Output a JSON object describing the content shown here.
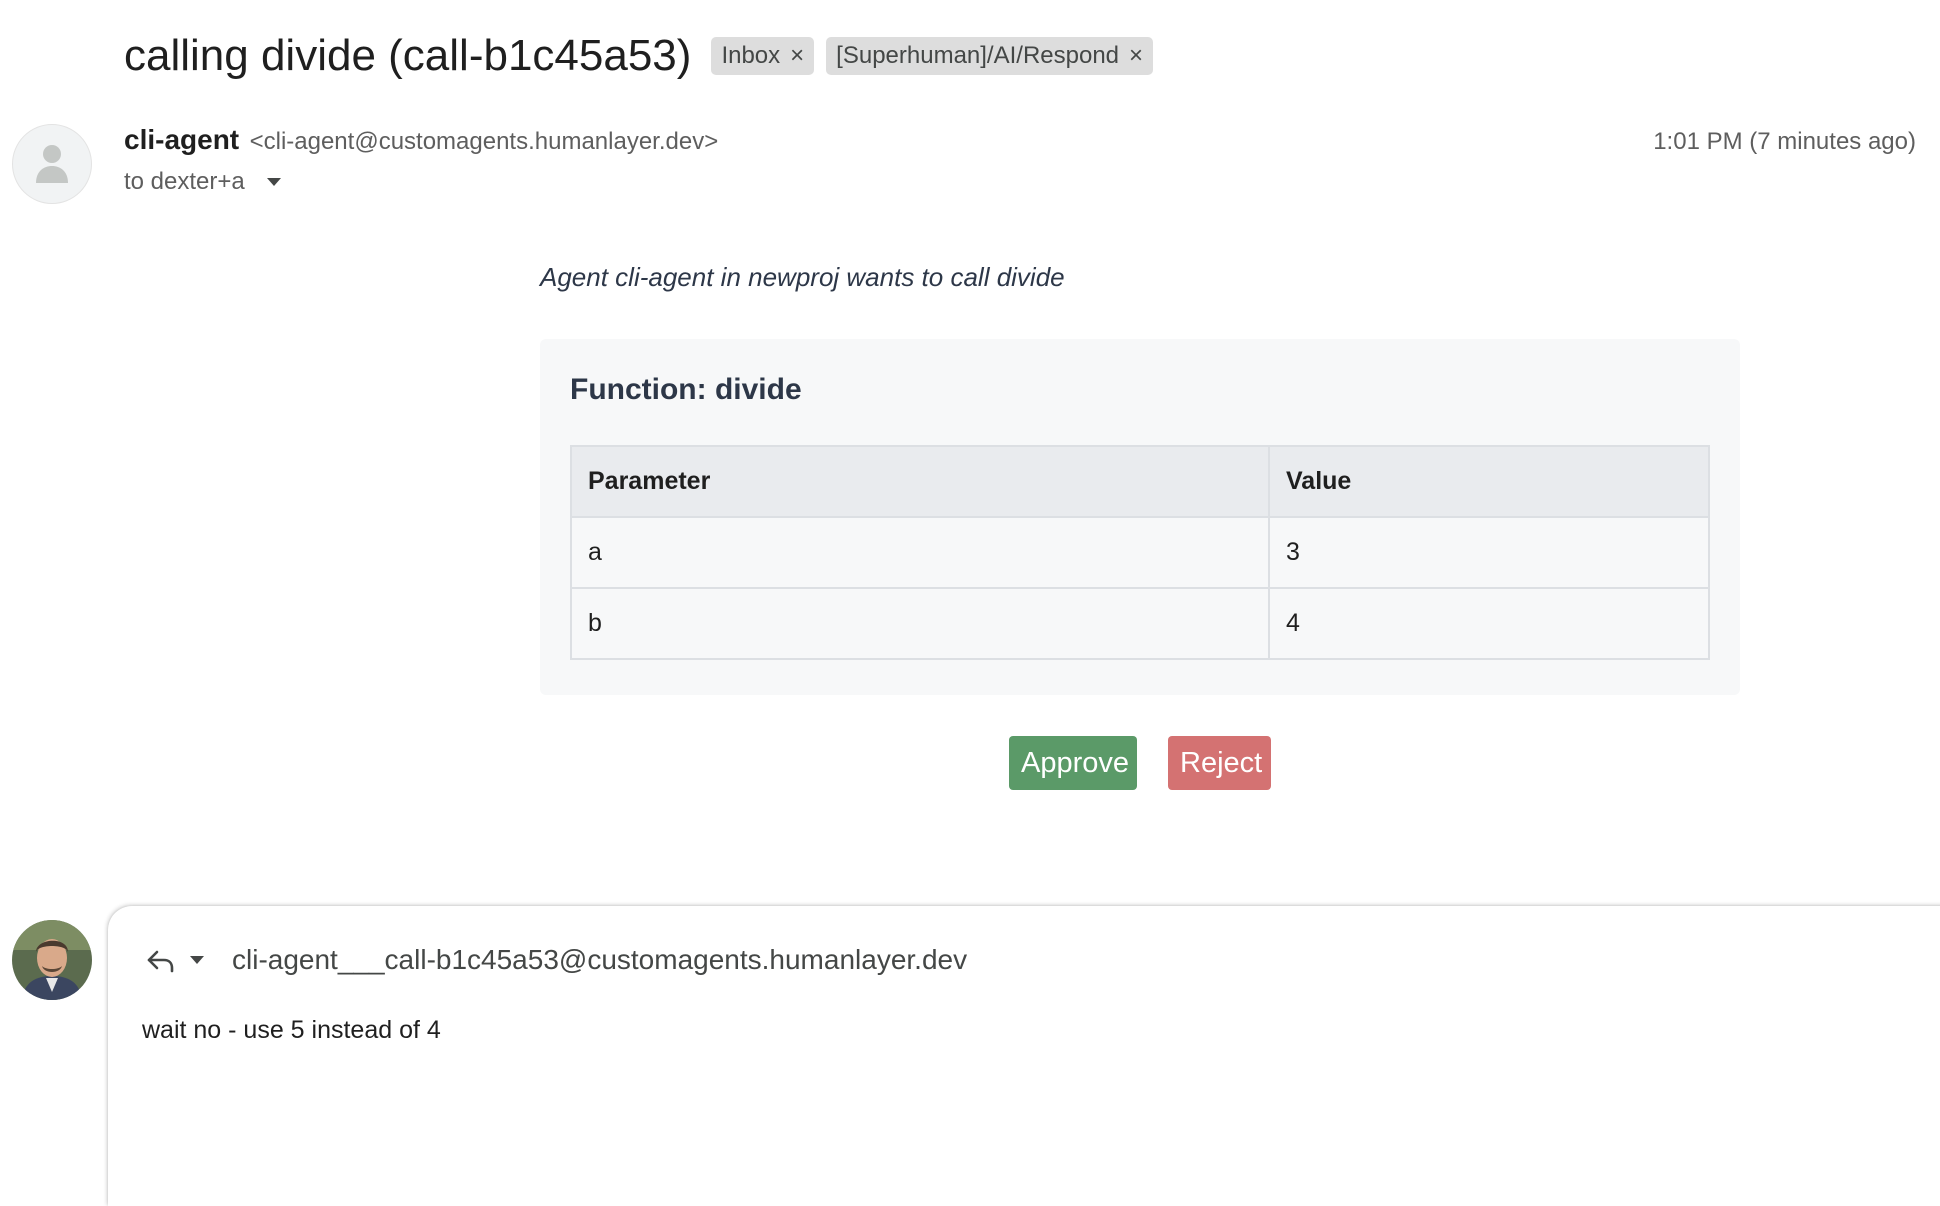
{
  "subject": "calling divide (call-b1c45a53)",
  "labels": [
    {
      "text": "Inbox",
      "remove": "×"
    },
    {
      "text": "[Superhuman]/AI/Respond",
      "remove": "×"
    }
  ],
  "sender": {
    "name": "cli-agent",
    "email": "<cli-agent@customagents.humanlayer.dev>",
    "to": "to dexter+a",
    "timestamp": "1:01 PM (7 minutes ago)",
    "avatar_icon": "person-icon"
  },
  "body": {
    "intro": "Agent cli-agent in newproj wants to call divide",
    "function_title": "Function: divide",
    "table": {
      "headers": [
        "Parameter",
        "Value"
      ],
      "rows": [
        [
          "a",
          "3"
        ],
        [
          "b",
          "4"
        ]
      ]
    },
    "approve_label": "Approve",
    "reject_label": "Reject",
    "colors": {
      "approve": "#5b9a68",
      "reject": "#d47272"
    }
  },
  "reply": {
    "to": "cli-agent___call-b1c45a53@customagents.humanlayer.dev",
    "text": "wait no - use 5 instead of 4",
    "icons": [
      "reply-icon",
      "chevron-down-icon"
    ]
  }
}
